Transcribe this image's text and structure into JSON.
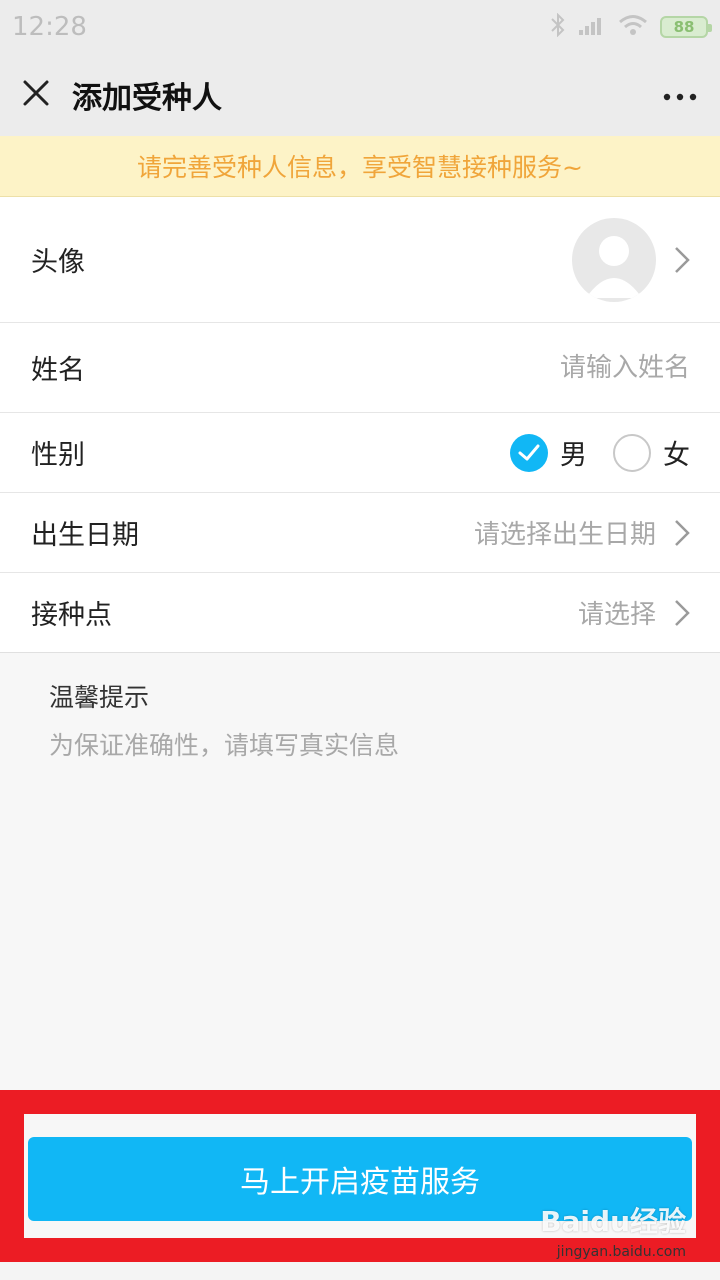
{
  "status_bar": {
    "time": "12:28",
    "battery": "88"
  },
  "nav": {
    "title": "添加受种人"
  },
  "notice": {
    "text": "请完善受种人信息，享受智慧接种服务~"
  },
  "form": {
    "avatar": {
      "label": "头像"
    },
    "name": {
      "label": "姓名",
      "placeholder": "请输入姓名",
      "value": ""
    },
    "gender": {
      "label": "性别",
      "options": [
        "男",
        "女"
      ],
      "selected": "男"
    },
    "birth": {
      "label": "出生日期",
      "placeholder": "请选择出生日期"
    },
    "site": {
      "label": "接种点",
      "placeholder": "请选择"
    }
  },
  "tips": {
    "title": "温馨提示",
    "body": "为保证准确性，请填写真实信息"
  },
  "submit": {
    "label": "马上开启疫苗服务"
  },
  "watermark": {
    "logo": "Baidu经验",
    "url": "jingyan.baidu.com"
  },
  "colors": {
    "accent": "#11b7f5",
    "notice_text": "#f0a53a",
    "notice_bg": "#fdf3c7",
    "highlight": "#ec1c24"
  }
}
